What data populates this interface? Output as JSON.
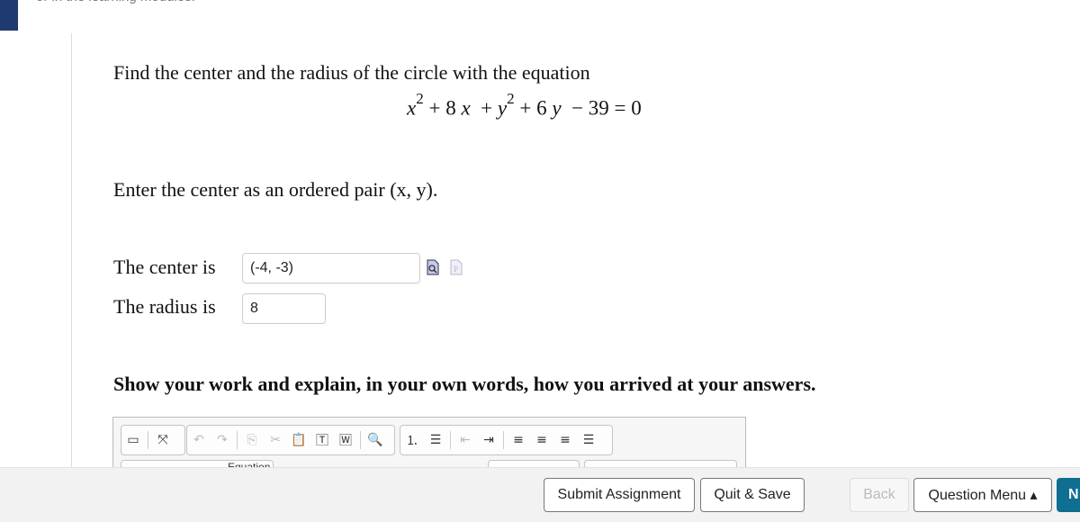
{
  "header": {
    "clipped_text": "or in the learning modules."
  },
  "question": {
    "prompt": "Find the center and the radius of the circle with the equation",
    "equation": {
      "x_var": "x",
      "x_exp": "2",
      "p1": "+ 8",
      "x2": "x",
      "p2": "+",
      "y_var": "y",
      "y_exp": "2",
      "p3": "+ 6",
      "y2": "y",
      "p4": "− 39 = 0"
    },
    "instruction": "Enter the center as an ordered pair (x, y).",
    "center_label": "The center is",
    "center_value": "(-4, -3)",
    "radius_label": "The radius is",
    "radius_value": "8",
    "show_work": "Show your work and explain, in your own words, how you arrived at your answers."
  },
  "editor": {
    "toolbar": [
      "show-blocks",
      "maximize",
      "undo",
      "redo",
      "copy",
      "cut",
      "paste",
      "paste-text",
      "paste-word",
      "find",
      "numbered-list",
      "bulleted-list",
      "outdent",
      "indent",
      "align-left",
      "align-center",
      "align-right",
      "justify"
    ],
    "second_row_label": "Equation"
  },
  "footer": {
    "submit": "Submit Assignment",
    "quit": "Quit & Save",
    "back": "Back",
    "question_menu": "Question Menu ▴",
    "next": "N"
  }
}
